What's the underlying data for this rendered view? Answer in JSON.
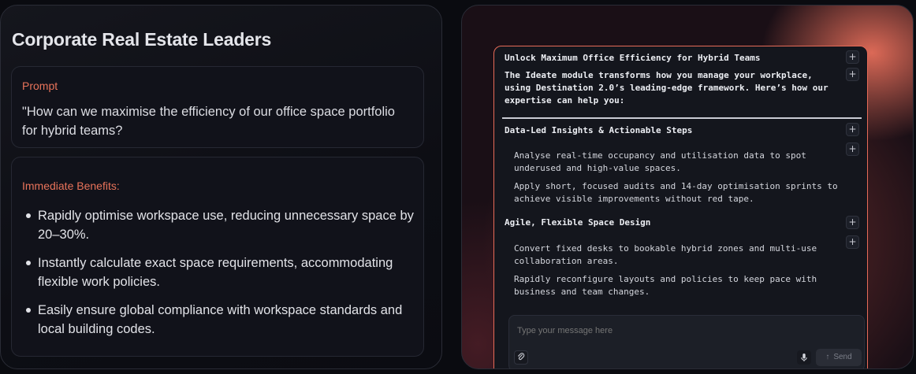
{
  "left": {
    "title": "Corporate Real Estate Leaders",
    "prompt_label": "Prompt",
    "prompt_text": "\"How can we maximise the efficiency of our office space portfolio for hybrid teams?",
    "benefits_label": "Immediate Benefits:",
    "benefits": [
      "Rapidly optimise workspace use, reducing unnecessary space by 20–30%.",
      "Instantly calculate exact space requirements, accommodating flexible work policies.",
      "Easily ensure global compliance with workspace standards and local building codes."
    ]
  },
  "chat": {
    "heading1": "Unlock Maximum Office Efficiency for Hybrid Teams",
    "intro_line1": "The Ideate module transforms how you manage your workplace,",
    "intro_line2": "using Destination 2.0’s leading-edge framework. Here’s how our",
    "intro_line3": "expertise can help you:",
    "section1_title": "Data-Led Insights & Actionable Steps",
    "s1_item1_line1": "Analyse real-time occupancy and utilisation data to spot",
    "s1_item1_line2": "underused and high-value spaces.",
    "s1_item2_line1": "Apply short, focused audits and 14-day optimisation sprints to",
    "s1_item2_line2": "achieve visible improvements without red tape.",
    "section2_title": "Agile, Flexible Space Design",
    "s2_item1_line1": "Convert fixed desks to bookable hybrid zones and multi-use",
    "s2_item1_line2": "collaboration areas.",
    "s2_item2_line1": "Rapidly reconfigure layouts and policies to keep pace with",
    "s2_item2_line2": "business and team changes.",
    "plus": "+",
    "composer_placeholder": "Type your message here",
    "send_label": "Send",
    "send_icon": "↑"
  },
  "icons": {
    "attach": "paperclip-icon",
    "mic": "microphone-icon",
    "send": "arrow-up-icon"
  },
  "colors": {
    "accent": "#e8735a",
    "background": "#0a0b10"
  }
}
